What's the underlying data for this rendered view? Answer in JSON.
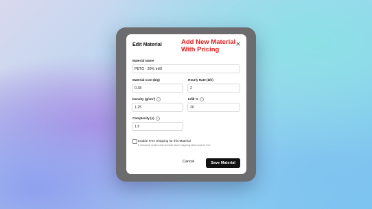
{
  "dialog": {
    "title": "Edit Material",
    "promo_text": "Add New Material With Pricing",
    "close_icon": "close-icon"
  },
  "fields": {
    "material_name": {
      "label": "Material Name",
      "value": "PETG - 20% Infill"
    },
    "material_cost": {
      "label": "Material Cost ($/g)",
      "value": "0.38"
    },
    "hourly_rate": {
      "label": "Hourly Rate ($/h)",
      "value": "2"
    },
    "density": {
      "label": "Density (g/cm³)",
      "value": "1.25",
      "icon": "info-icon"
    },
    "infill": {
      "label": "Infill %",
      "value": "20",
      "icon": "info-icon"
    },
    "complexity": {
      "label": "Complexity (x)",
      "value": "1.5",
      "icon": "info-icon"
    }
  },
  "free_shipping": {
    "label": "Enable Free Shipping for this Material",
    "help": "If checked, orders will override store shipping rates and be free",
    "checked": false
  },
  "actions": {
    "cancel_label": "Cancel",
    "save_label": "Save Material"
  },
  "colors": {
    "promo_red": "#e11d1d",
    "primary_button": "#111111"
  }
}
